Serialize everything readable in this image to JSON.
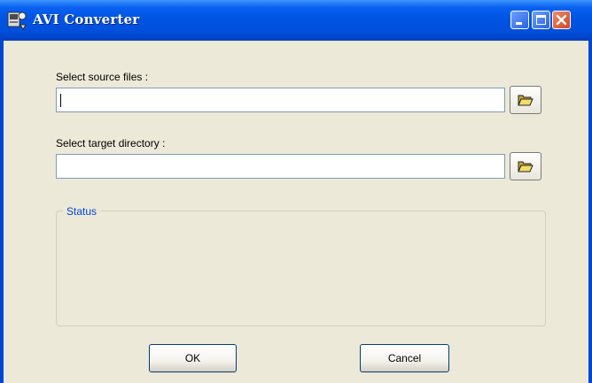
{
  "window": {
    "title": "AVI Converter"
  },
  "form": {
    "source_label": "Select source files :",
    "source_value": "",
    "target_label": "Select target directory :",
    "target_value": ""
  },
  "status": {
    "legend": "Status"
  },
  "buttons": {
    "ok": "OK",
    "cancel": "Cancel"
  },
  "icons": {
    "app": "converter-app-icon",
    "browse": "folder-open-icon",
    "minimize": "minimize-icon",
    "maximize": "maximize-icon",
    "close": "close-icon"
  },
  "colors": {
    "titlebar": "#0054e3",
    "window_bg": "#ece9d8",
    "status_legend": "#0046d5"
  }
}
